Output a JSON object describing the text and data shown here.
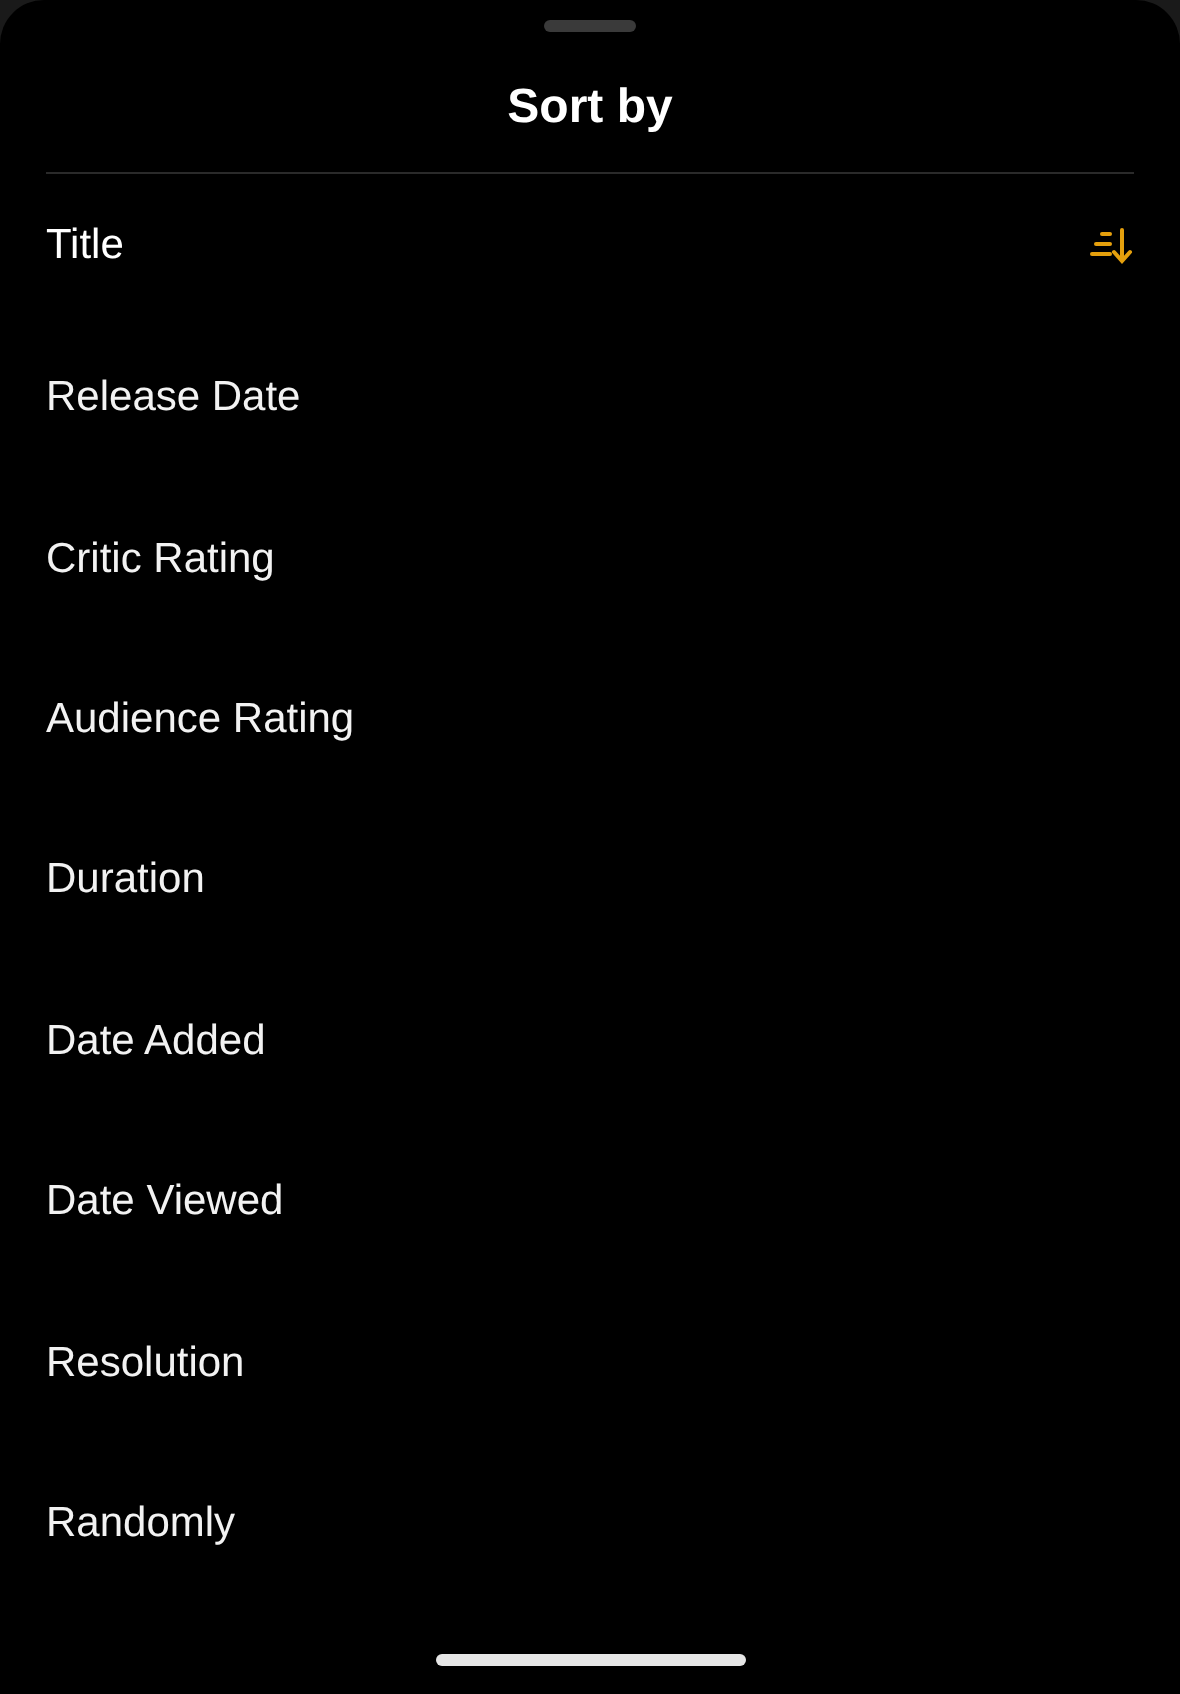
{
  "sheet": {
    "title": "Sort by"
  },
  "options": [
    {
      "label": "Title",
      "selected": true
    },
    {
      "label": "Release Date",
      "selected": false
    },
    {
      "label": "Critic Rating",
      "selected": false
    },
    {
      "label": "Audience Rating",
      "selected": false
    },
    {
      "label": "Duration",
      "selected": false
    },
    {
      "label": "Date Added",
      "selected": false
    },
    {
      "label": "Date Viewed",
      "selected": false
    },
    {
      "label": "Resolution",
      "selected": false
    },
    {
      "label": "Randomly",
      "selected": false
    }
  ]
}
